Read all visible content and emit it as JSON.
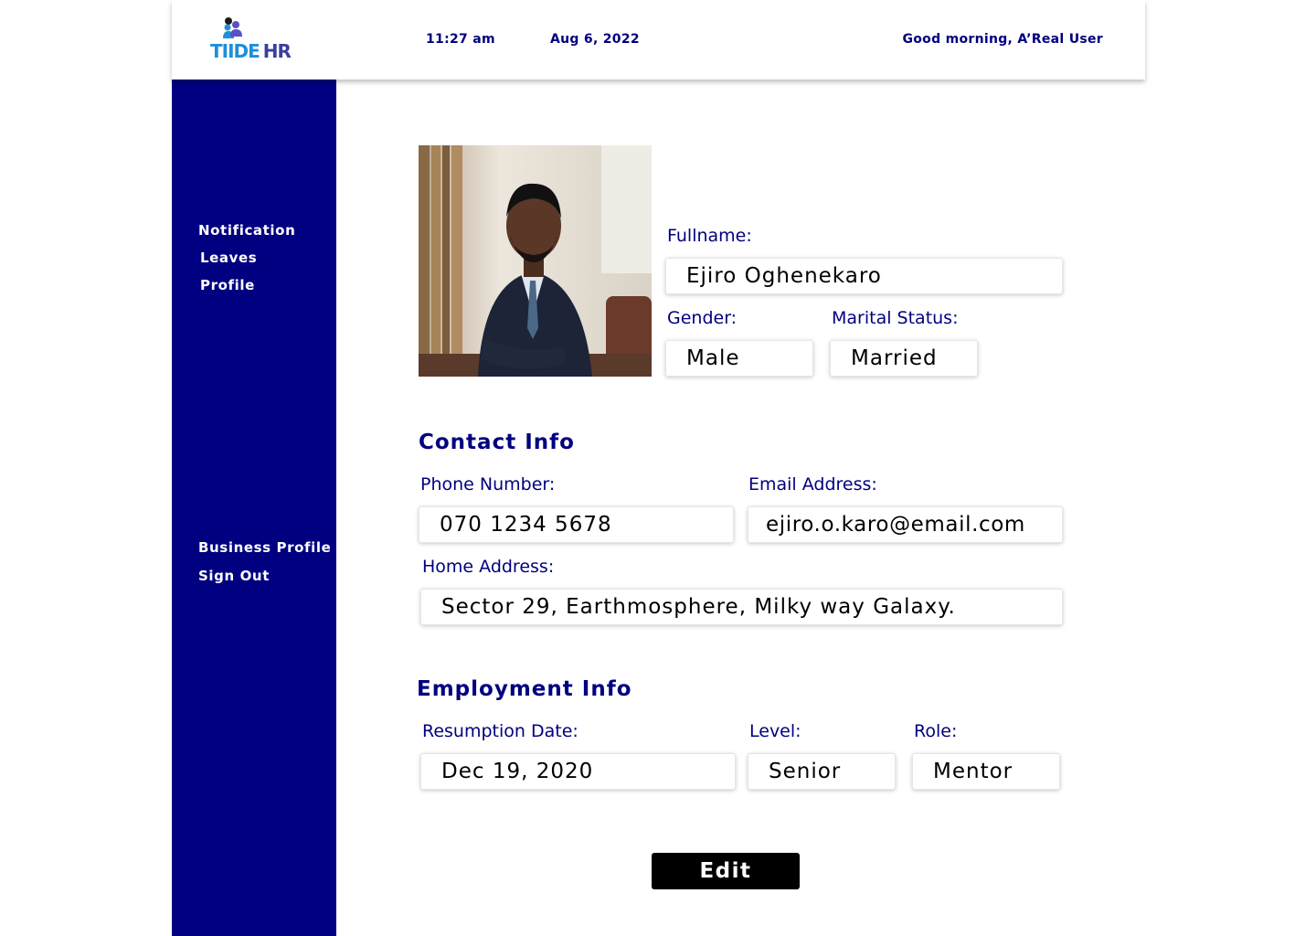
{
  "header": {
    "logo": {
      "part1": "TIIDE",
      "part2": "HR"
    },
    "time": "11:27 am",
    "date": "Aug 6, 2022",
    "greeting": "Good morning, A’Real User"
  },
  "sidebar": {
    "items": [
      {
        "label": "Notification"
      },
      {
        "label": "Leaves"
      },
      {
        "label": "Profile"
      }
    ],
    "bottom_items": [
      {
        "label": "Business Profile"
      },
      {
        "label": "Sign Out"
      }
    ]
  },
  "profile": {
    "fullname_label": "Fullname:",
    "fullname": "Ejiro Oghenekaro",
    "gender_label": "Gender:",
    "gender": "Male",
    "marital_label": "Marital Status:",
    "marital": "Married"
  },
  "contact": {
    "title": "Contact Info",
    "phone_label": "Phone Number:",
    "phone": "070 1234 5678",
    "email_label": "Email Address:",
    "email": "ejiro.o.karo@email.com",
    "address_label": "Home Address:",
    "address": "Sector 29, Earthmosphere, Milky way Galaxy."
  },
  "employment": {
    "title": "Employment Info",
    "resumption_label": "Resumption Date:",
    "resumption": "Dec 19, 2020",
    "level_label": "Level:",
    "level": "Senior",
    "role_label": "Role:",
    "role": "Mentor"
  },
  "actions": {
    "edit_label": "Edit"
  },
  "colors": {
    "primary": "#000080",
    "logo_blue": "#1e8fd8",
    "logo_indigo": "#3b3f9c",
    "button": "#000000"
  }
}
